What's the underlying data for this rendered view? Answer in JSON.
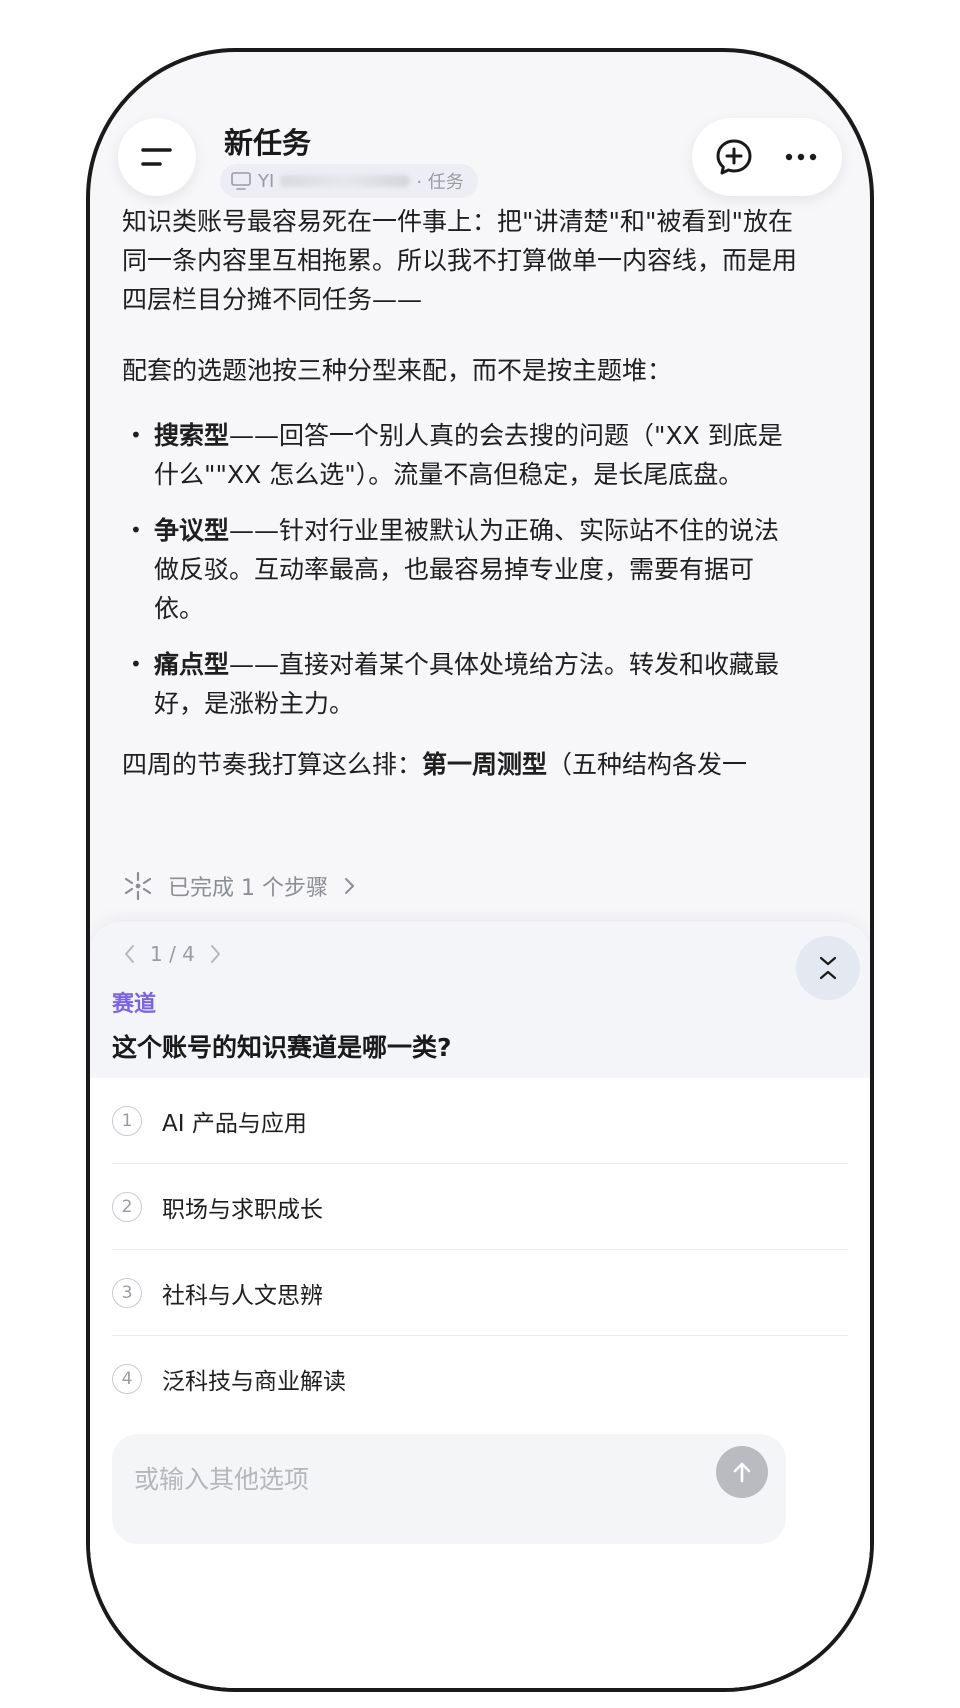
{
  "header": {
    "title": "新任务",
    "subtitle_prefix": "YI",
    "subtitle_suffix": "· 任务"
  },
  "message": {
    "p1": "知识类账号最容易死在一件事上：把\"讲清楚\"和\"被看到\"放在同一条内容里互相拖累。所以我不打算做单一内容线，而是用四层栏目分摊不同任务——",
    "p2": "配套的选题池按三种分型来配，而不是按主题堆：",
    "bullets": [
      {
        "bold": "搜索型",
        "text": "——回答一个别人真的会去搜的问题（\"XX 到底是什么\"\"XX 怎么选\"）。流量不高但稳定，是长尾底盘。"
      },
      {
        "bold": "争议型",
        "text": "——针对行业里被默认为正确、实际站不住的说法做反驳。互动率最高，也最容易掉专业度，需要有据可依。"
      },
      {
        "bold": "痛点型",
        "text": "——直接对着某个具体处境给方法。转发和收藏最好，是涨粉主力。"
      }
    ],
    "p4_prefix": "四周的节奏我打算这么排：",
    "p4_bold": "第一周测型",
    "p4_suffix": "（五种结构各发一"
  },
  "steps": {
    "label": "已完成 1 个步骤"
  },
  "question_sheet": {
    "pager": "1 / 4",
    "category": "赛道",
    "question": "这个账号的知识赛道是哪一类?",
    "options": [
      {
        "num": "1",
        "label": "AI 产品与应用"
      },
      {
        "num": "2",
        "label": "职场与求职成长"
      },
      {
        "num": "3",
        "label": "社科与人文思辨"
      },
      {
        "num": "4",
        "label": "泛科技与商业解读"
      }
    ],
    "input_placeholder": "或输入其他选项"
  },
  "colors": {
    "accent": "#7b63e8",
    "send_button": "#b9bbc0"
  }
}
